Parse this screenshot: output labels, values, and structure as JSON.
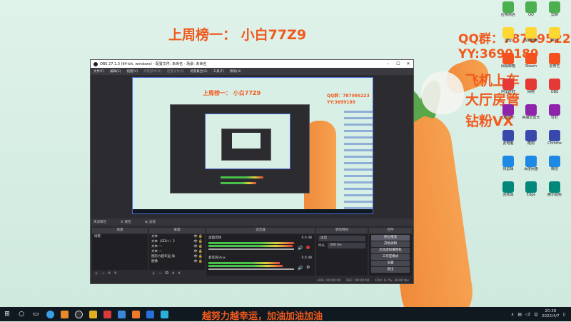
{
  "overlay": {
    "top": "上周榜一：  小白77Z9",
    "qq": "QQ群：787095223",
    "yy": "YY:3699189",
    "right1": "飞机上车",
    "right2": "大厅房管",
    "right3": "钻粉VX",
    "bottom": "越努力越幸运，加油加油加油"
  },
  "obs": {
    "title": "OBS 27.1.3 (64-bit, windows) - 配置文件: 未命名 - 场景: 未命名",
    "menu": [
      "文件(F)",
      "编辑(E)",
      "视图(V)",
      "停靠部件(D)",
      "配置文件(P)",
      "场景集合(S)",
      "工具(T)",
      "帮助(H)"
    ],
    "toolbar_label": "来源属性",
    "toolbar_props": "属性",
    "toolbar_filters": "滤镜",
    "docks": {
      "scenes": "场景",
      "sources": "来源",
      "mixer": "混音器",
      "transitions": "转场特效",
      "controls": "控件"
    },
    "scene_item": "场景",
    "sources": [
      "文本",
      "文本（GDI+）2",
      "文本 一",
      "文本 一",
      "图形力越幸运 加",
      "图像"
    ],
    "mixer": [
      {
        "name": "桌面音频",
        "db": "0.0 dB"
      },
      {
        "name": "麦克风/Aux",
        "db": "0.0 dB"
      }
    ],
    "transition": "淡出",
    "duration_label": "时长",
    "duration_value": "300 ms",
    "controls": [
      "停止推流",
      "开始录制",
      "启动虚拟摄像机",
      "工作室模式",
      "设置",
      "退出"
    ],
    "status": {
      "live": "LIVE: 00:00:00",
      "rec": "REC: 00:00:00",
      "cpu": "CPU: 0.7%, 30.00 fps"
    }
  },
  "taskbar": {
    "time": "20:38",
    "date": "2022/4/7"
  },
  "desktop_icons": [
    "应用商店",
    "迅雷",
    "网易邮箱",
    "阿里旺旺",
    "QQ音乐",
    "此电脑",
    "快剪辑",
    "回收站",
    "QQ",
    "控制面板",
    "Steam",
    "网络",
    "网易云音乐",
    "酷狗",
    "百度网盘",
    "Edge",
    "剪映",
    "WPS",
    "爱奇艺",
    "OBS",
    "钉钉",
    "Chrome",
    "微信",
    "腾讯视频"
  ]
}
